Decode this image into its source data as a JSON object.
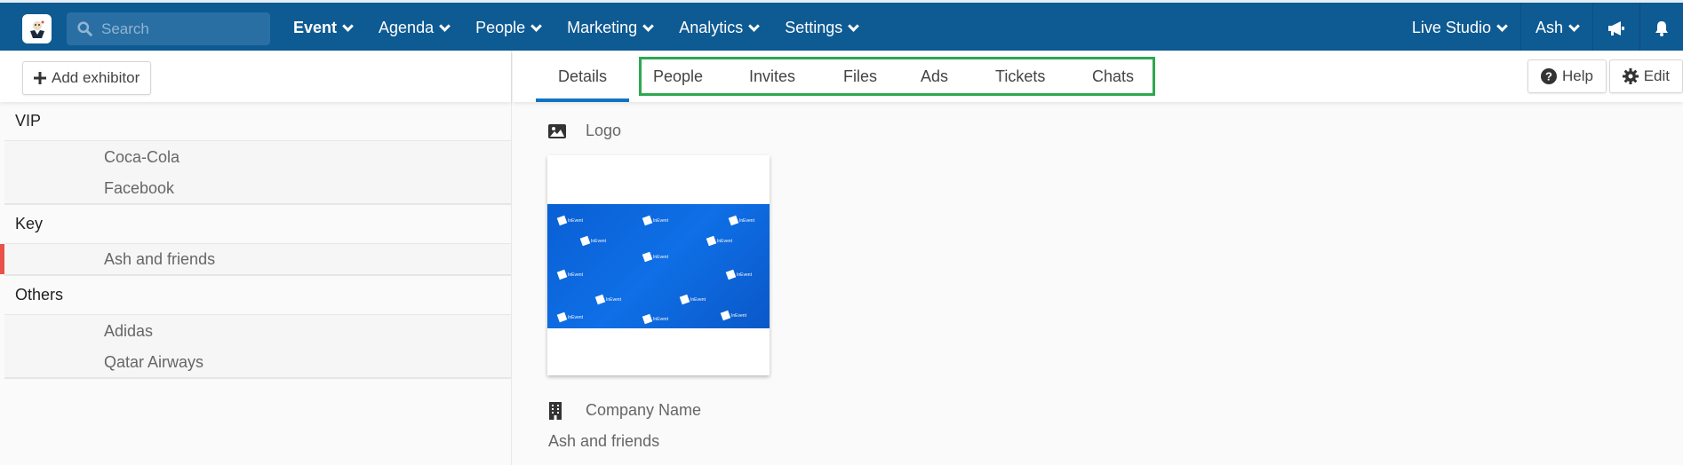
{
  "topbar": {
    "search_placeholder": "Search",
    "nav": [
      {
        "label": "Event",
        "active": true
      },
      {
        "label": "Agenda"
      },
      {
        "label": "People"
      },
      {
        "label": "Marketing"
      },
      {
        "label": "Analytics"
      },
      {
        "label": "Settings"
      }
    ],
    "right": {
      "studio": "Live Studio",
      "user": "Ash",
      "announce_icon": "bullhorn-icon",
      "notify_icon": "bell-icon"
    },
    "colors": {
      "bar": "#0e5a92",
      "search": "#2a6fa3"
    }
  },
  "sidebar": {
    "add_button": "Add exhibitor",
    "groups": [
      {
        "name": "VIP",
        "items": [
          "Coca-Cola",
          "Facebook"
        ]
      },
      {
        "name": "Key",
        "items": [
          "Ash and friends"
        ]
      },
      {
        "name": "Others",
        "items": [
          "Adidas",
          "Qatar Airways"
        ]
      }
    ],
    "selected": "Ash and friends",
    "selected_color": "#e8524a"
  },
  "main": {
    "tabs": [
      {
        "label": "Details",
        "active": true
      },
      {
        "label": "People"
      },
      {
        "label": "Invites"
      },
      {
        "label": "Files"
      },
      {
        "label": "Ads"
      },
      {
        "label": "Tickets"
      },
      {
        "label": "Chats"
      }
    ],
    "help_button": "Help",
    "edit_button": "Edit",
    "logo_label": "Logo",
    "logo_brand_text": "InEvent",
    "company_label": "Company Name",
    "company_value": "Ash and friends",
    "accent": "#0f73c4",
    "highlight": "#2ea84f"
  }
}
